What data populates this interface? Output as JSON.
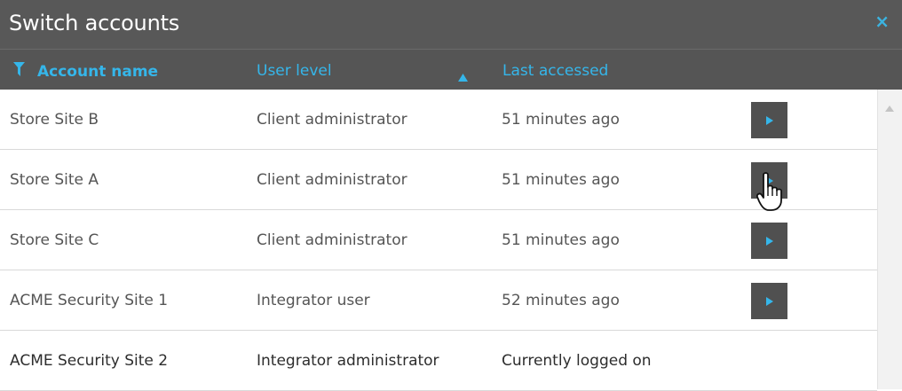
{
  "dialog": {
    "title": "Switch accounts",
    "close": "×"
  },
  "columns": {
    "name": "Account name",
    "level": "User level",
    "last": "Last accessed"
  },
  "rows": [
    {
      "name": "Store Site B",
      "level": "Client administrator",
      "last": "51 minutes ago",
      "switchable": true
    },
    {
      "name": "Store Site A",
      "level": "Client administrator",
      "last": "51 minutes ago",
      "switchable": true
    },
    {
      "name": "Store Site C",
      "level": "Client administrator",
      "last": "51 minutes ago",
      "switchable": true
    },
    {
      "name": "ACME Security Site 1",
      "level": "Integrator user",
      "last": "52 minutes ago",
      "switchable": true
    },
    {
      "name": "ACME Security Site 2",
      "level": "Integrator administrator",
      "last": "Currently logged on",
      "switchable": false
    }
  ],
  "colors": {
    "title_bar": "#585858",
    "header_bar": "#555555",
    "accent": "#35b6ea",
    "button": "#505050"
  },
  "icons": {
    "filter": "funnel-icon",
    "sort": "sort-asc-icon",
    "play": "play-icon",
    "close": "close-icon",
    "cursor": "hand-pointer-icon"
  }
}
